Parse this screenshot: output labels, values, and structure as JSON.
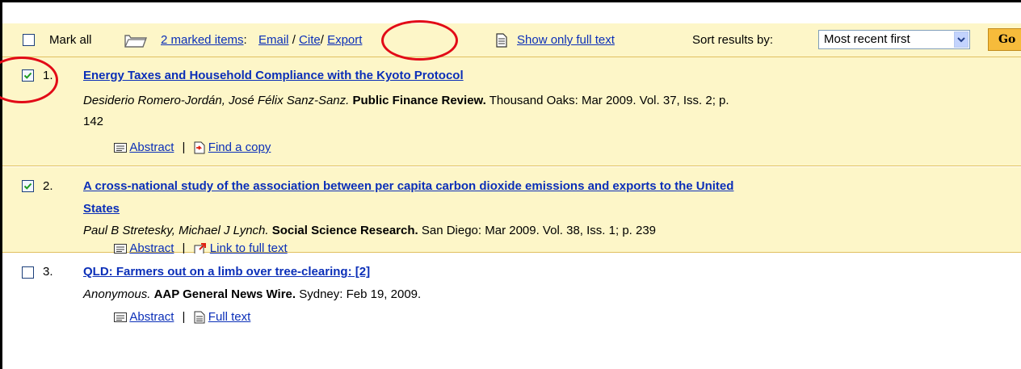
{
  "toolbar": {
    "mark_all": "Mark all",
    "marked_items": "2 marked items",
    "colon": ":",
    "email": "Email",
    "slash1": "/",
    "cite": "Cite",
    "slash2": "/",
    "export": "Export",
    "show_full_text": "Show only full text",
    "sort_label": "Sort results by:",
    "sort_value": "Most recent first",
    "go": "Go"
  },
  "results": [
    {
      "number": "1.",
      "checked": true,
      "title": "Energy Taxes and Household Compliance with the Kyoto Protocol",
      "authors": "Desiderio Romero-Jordán, José Félix Sanz-Sanz.",
      "publication": "Public Finance Review.",
      "details": "Thousand Oaks: Mar 2009. Vol. 37, Iss. 2; p.",
      "details_wrap": "142",
      "link1": "Abstract",
      "link2": "Find a copy"
    },
    {
      "number": "2.",
      "checked": true,
      "title": "A cross-national study of the association between per capita carbon dioxide emissions and exports to the United",
      "title_wrap": "States",
      "authors": "Paul B Stretesky, Michael J Lynch.",
      "publication": "Social Science Research.",
      "details": "San Diego: Mar 2009. Vol. 38, Iss. 1; p. 239",
      "link1": "Abstract",
      "link2": "Link to full text"
    },
    {
      "number": "3.",
      "checked": false,
      "title": "QLD: Farmers out on a limb over tree-clearing: [2]",
      "authors": "Anonymous.",
      "publication": "AAP General News Wire.",
      "details": "Sydney: Feb 19, 2009.",
      "link1": "Abstract",
      "link2": "Full text"
    }
  ],
  "icons": {
    "folder": "folder-icon",
    "document": "document-icon",
    "abstract": "abstract-icon",
    "find_copy": "find-copy-icon",
    "external_link": "external-link-icon"
  },
  "colors": {
    "highlight_bg": "#fdf6c8",
    "link": "#0b2fb8",
    "annotation_circle": "#e20a17",
    "go_button": "#f6bb3b"
  }
}
